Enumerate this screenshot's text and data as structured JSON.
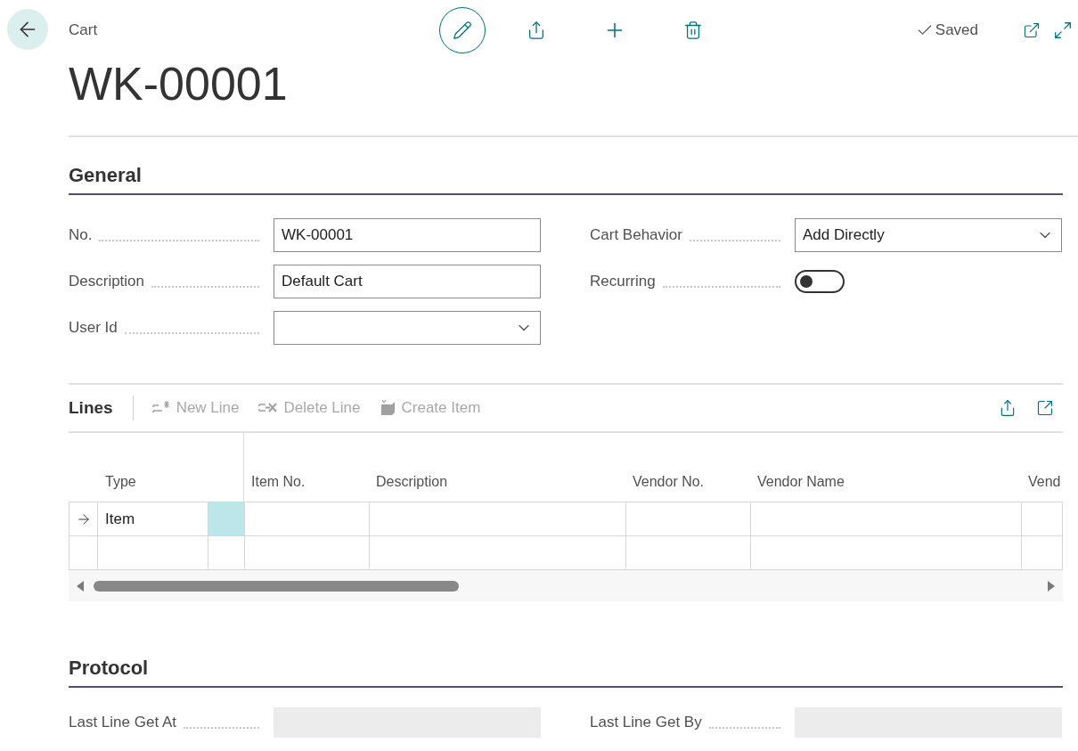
{
  "breadcrumb": "Cart",
  "title": "WK-00001",
  "status": "Saved",
  "general": {
    "heading": "General",
    "left": [
      {
        "label": "No.",
        "kind": "text",
        "value": "WK-00001"
      },
      {
        "label": "Description",
        "kind": "text",
        "value": "Default Cart"
      },
      {
        "label": "User Id",
        "kind": "select"
      }
    ],
    "right": [
      {
        "label": "Cart Behavior",
        "kind": "select",
        "value": "Add Directly"
      },
      {
        "label": "Recurring",
        "kind": "toggle",
        "on": false
      }
    ]
  },
  "lines": {
    "heading": "Lines",
    "actions": [
      {
        "label": "New Line",
        "kind": "new",
        "disabled": true
      },
      {
        "label": "Delete Line",
        "kind": "delete",
        "disabled": true
      },
      {
        "label": "Create Item",
        "kind": "create",
        "disabled": true
      }
    ],
    "columns": [
      "Type",
      "Item No.",
      "Description",
      "Vendor No.",
      "Vendor Name",
      "Vend"
    ],
    "rows": [
      {
        "selected": true,
        "type": "Item"
      },
      {
        "selected": false
      }
    ]
  },
  "protocol": {
    "heading": "Protocol",
    "left": {
      "label": "Last Line Get At"
    },
    "right": {
      "label": "Last Line Get By"
    }
  }
}
